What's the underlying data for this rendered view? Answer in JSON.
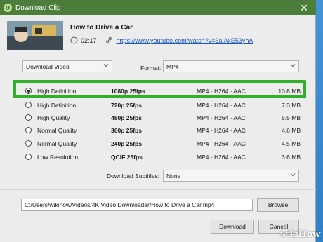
{
  "window": {
    "title": "Download Clip",
    "close_glyph": "✕"
  },
  "video": {
    "title": "How to Drive a Car",
    "duration": "02:17",
    "url": "https://www.youtube.com/watch?v=3alAxE53yhA"
  },
  "mode_select": {
    "value": "Download Video"
  },
  "format": {
    "label": "Format:",
    "value": "MP4"
  },
  "rows": [
    {
      "quality": "High Definition",
      "resolution": "1080p 25fps",
      "codec": "MP4 · H264 · AAC",
      "size": "10.8 MB",
      "selected": true
    },
    {
      "quality": "High Definition",
      "resolution": "720p 25fps",
      "codec": "MP4 · H264 · AAC",
      "size": "7.3 MB",
      "selected": false
    },
    {
      "quality": "High Quality",
      "resolution": "480p 25fps",
      "codec": "MP4 · H264 · AAC",
      "size": "5.5 MB",
      "selected": false
    },
    {
      "quality": "Normal Quality",
      "resolution": "360p 25fps",
      "codec": "MP4 · H264 · AAC",
      "size": "4.6 MB",
      "selected": false
    },
    {
      "quality": "Normal Quality",
      "resolution": "240p 25fps",
      "codec": "MP4 · H264 · AAC",
      "size": "4.5 MB",
      "selected": false
    },
    {
      "quality": "Low Resolution",
      "resolution": "QCIF 25fps",
      "codec": "MP4 · H264 · AAC",
      "size": "3.6 MB",
      "selected": false
    }
  ],
  "subtitles": {
    "label": "Download Subtitles:",
    "value": "None"
  },
  "save_path": {
    "value": "C:/Users/wikihow/Videos/4K Video Downloader/How to Drive a Car.mp4"
  },
  "buttons": {
    "browse": "Browse",
    "download": "Download",
    "cancel": "Cancel"
  },
  "watermark": {
    "wiki": "wiki",
    "how": "How"
  },
  "colors": {
    "titlebar": "#4a7e3a",
    "highlight": "#2fb02a",
    "link": "#1a56c0"
  }
}
